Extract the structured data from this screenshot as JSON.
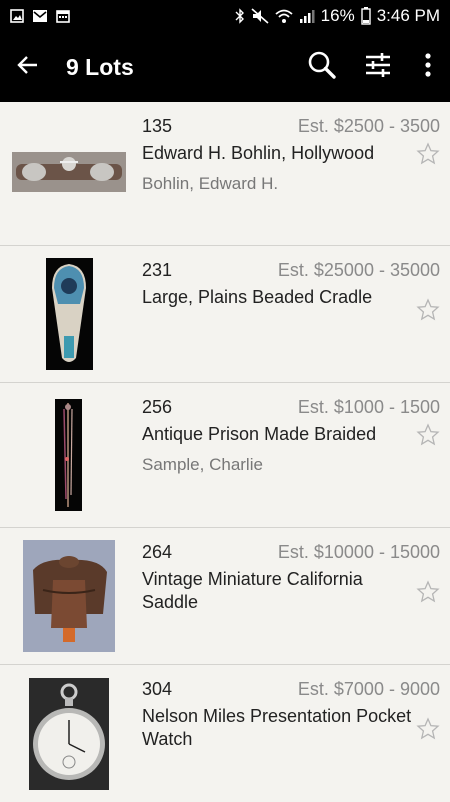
{
  "status": {
    "battery": "16%",
    "time": "3:46 PM"
  },
  "appbar": {
    "title": "9 Lots"
  },
  "lots": [
    {
      "number": "135",
      "estimate": "Est. $2500 - 3500",
      "name": "Edward H. Bohlin, Hollywood",
      "artist": "Bohlin, Edward H."
    },
    {
      "number": "231",
      "estimate": "Est. $25000 - 35000",
      "name": "Large, Plains Beaded Cradle",
      "artist": ""
    },
    {
      "number": "256",
      "estimate": "Est. $1000 - 1500",
      "name": "Antique Prison Made Braided",
      "artist": "Sample, Charlie"
    },
    {
      "number": "264",
      "estimate": "Est. $10000 - 15000",
      "name": "Vintage Miniature California Saddle",
      "artist": ""
    },
    {
      "number": "304",
      "estimate": "Est. $7000 - 9000",
      "name": "Nelson Miles Presentation Pocket Watch",
      "artist": ""
    }
  ]
}
